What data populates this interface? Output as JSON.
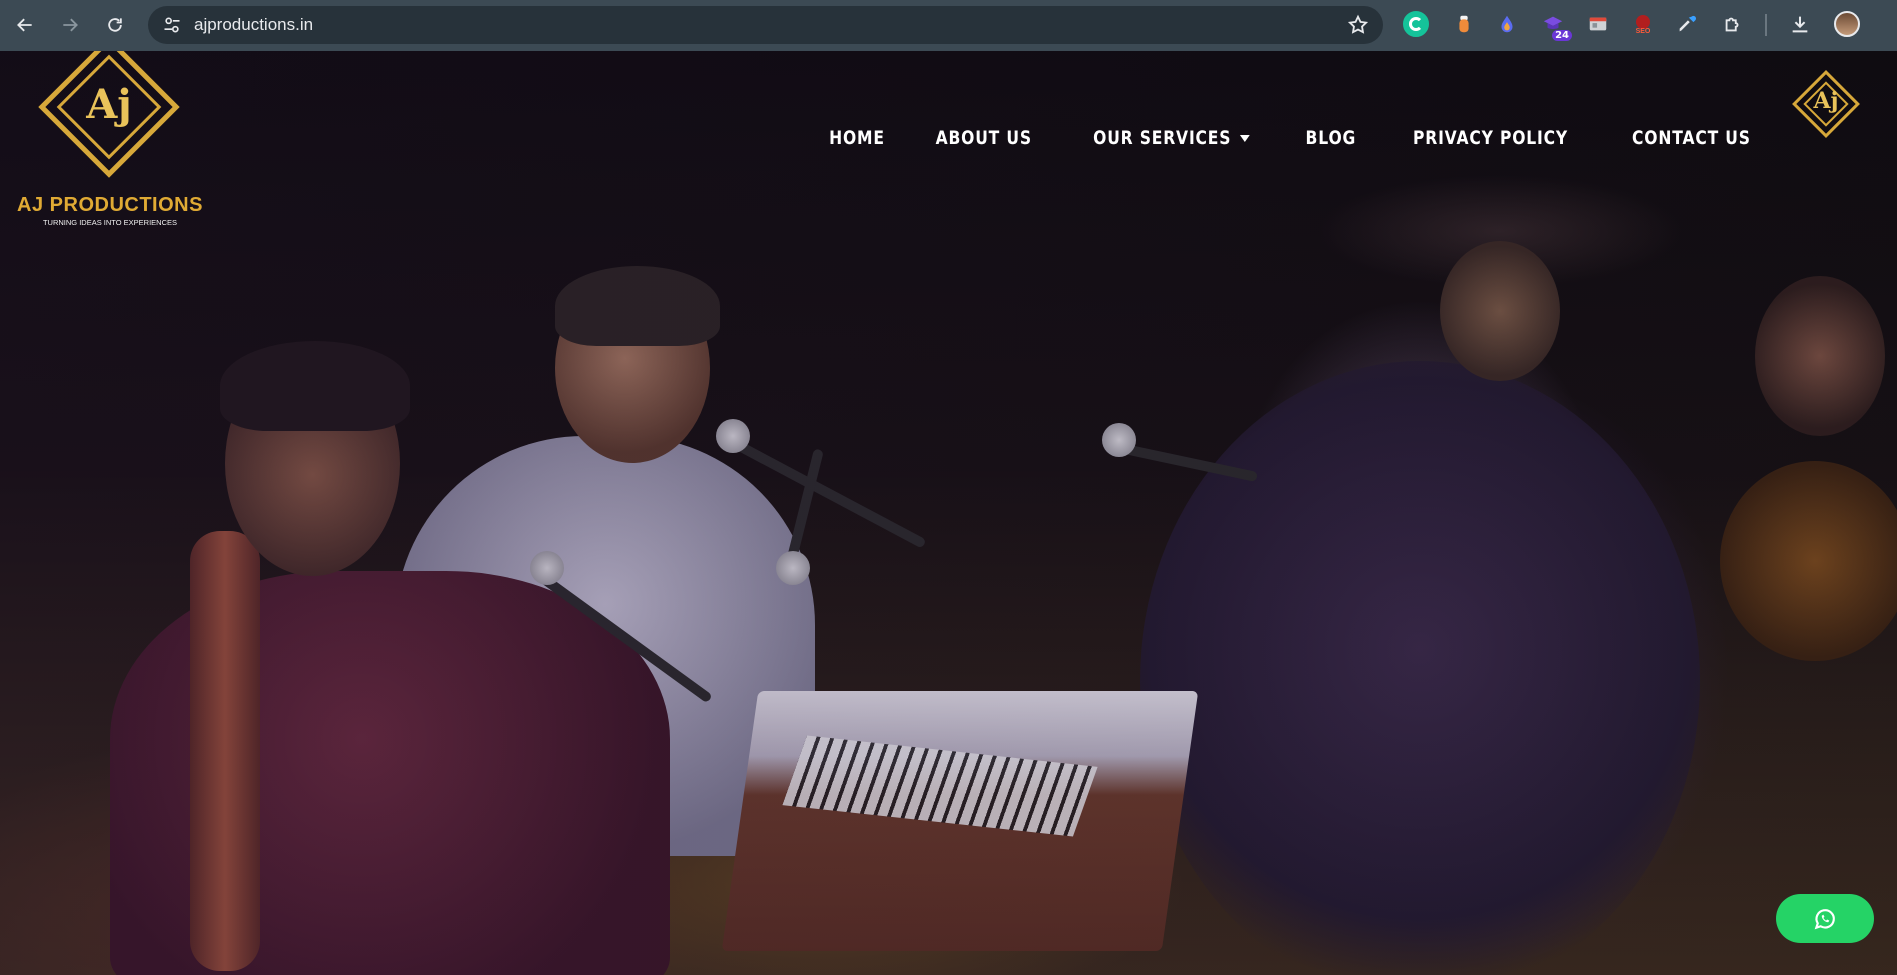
{
  "browser": {
    "url": "ajproductions.in",
    "extension_badge": "24"
  },
  "site": {
    "logo_monogram": "Aj",
    "logo_name": "AJ PRODUCTIONS",
    "logo_tagline": "TURNING IDEAS INTO EXPERIENCES",
    "logo_small_monogram": "Aj",
    "nav": {
      "home": "HOME",
      "about": "ABOUT US",
      "services": "OUR SERVICES",
      "blog": "BLOG",
      "privacy": "PRIVACY POLICY",
      "contact": "CONTACT US"
    }
  },
  "colors": {
    "brand_gold": "#d7a83a",
    "whatsapp_green": "#25d366",
    "chrome_bar": "#3c4a54"
  },
  "icons": [
    "back-arrow-icon",
    "forward-arrow-icon",
    "reload-icon",
    "site-settings-icon",
    "bookmark-star-icon",
    "grammarly-icon",
    "extension-icon",
    "download-icon",
    "profile-avatar",
    "whatsapp-icon"
  ]
}
